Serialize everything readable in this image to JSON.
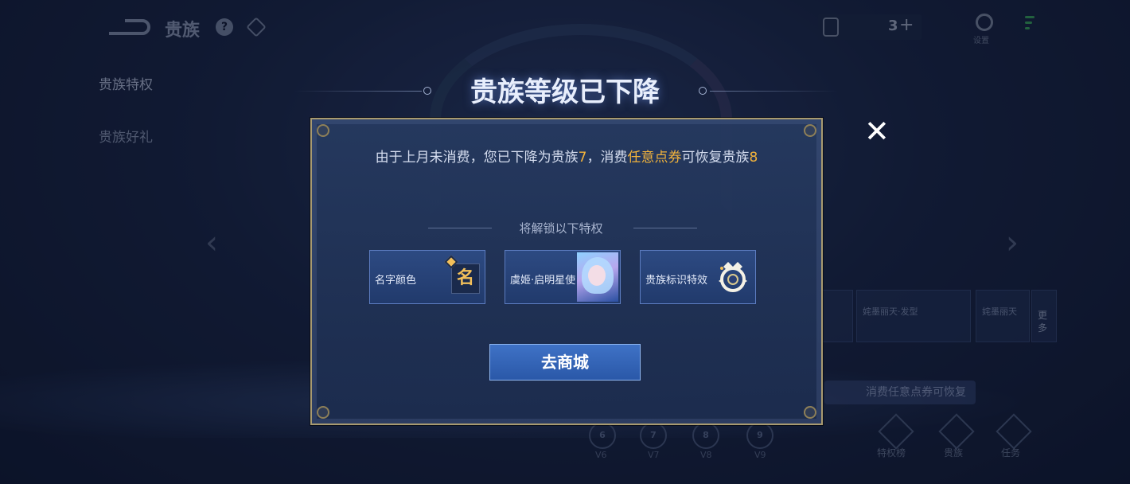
{
  "header": {
    "title": "贵族",
    "help_icon": "?",
    "coupon_count": "3",
    "coupon_add": "+",
    "settings_label": "设置"
  },
  "sidebar": {
    "items": [
      {
        "label": "贵族特权"
      },
      {
        "label": "贵族好礼"
      }
    ]
  },
  "background": {
    "card_1_text": "姹墨丽天·发型",
    "card_2_text": "姹墨丽天",
    "more_label": "更多",
    "hint": "消费任意点券可恢复",
    "levels": [
      "6",
      "7",
      "8",
      "9"
    ],
    "level_labels": [
      "V6",
      "V7",
      "V8",
      "V9"
    ],
    "bottom_tabs": [
      "特权榜",
      "贵族",
      "任务"
    ]
  },
  "modal": {
    "title": "贵族等级已下降",
    "message_part1": "由于上月未消费，您已下降为贵族",
    "message_level_down": "7",
    "message_part2": "，消费",
    "message_highlight": "任意点券",
    "message_part3": "可恢复贵族",
    "message_level_restore": "8",
    "unlock_title": "将解锁以下特权",
    "privileges": [
      {
        "label": "名字颜色",
        "icon": "name-color-icon",
        "icon_text": "名"
      },
      {
        "label": "虞姬·启明星使",
        "icon": "skin-avatar-icon"
      },
      {
        "label": "贵族标识特效",
        "icon": "noble-emblem-icon"
      }
    ],
    "shop_button": "去商城",
    "close_symbol": "✕"
  },
  "colors": {
    "highlight": "#f2b33c",
    "button": "#3f72c6"
  }
}
